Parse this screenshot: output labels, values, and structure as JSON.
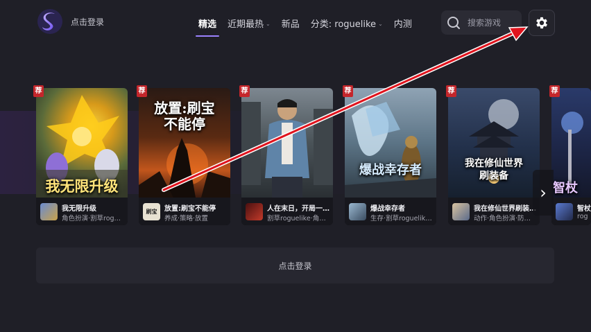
{
  "header": {
    "login_label": "点击登录",
    "nav": [
      {
        "label": "精选",
        "active": true,
        "dropdown": false
      },
      {
        "label": "近期最热",
        "active": false,
        "dropdown": true
      },
      {
        "label": "新品",
        "active": false,
        "dropdown": false
      },
      {
        "label": "分类: roguelike",
        "active": false,
        "dropdown": true
      },
      {
        "label": "内测",
        "active": false,
        "dropdown": false
      }
    ],
    "search_placeholder": "搜索游戏"
  },
  "cards": [
    {
      "art_title": "我无限升级",
      "name": "我无限升级",
      "tags": "角色扮演·割草rog…",
      "badge": "荐",
      "thumb_text": ""
    },
    {
      "art_title": "放置:刷宝\n不能停",
      "name": "放置:刷宝不能停",
      "tags": "养成·策略·放置",
      "badge": "荐",
      "thumb_text": "刷宝"
    },
    {
      "art_title": "",
      "name": "人在末日，开局一…",
      "tags": "割草roguelike·角…",
      "badge": "荐",
      "thumb_text": ""
    },
    {
      "art_title": "爆战幸存者",
      "name": "爆战幸存者",
      "tags": "生存·割草roguelik…",
      "badge": "荐",
      "thumb_text": ""
    },
    {
      "art_title": "我在修仙世界\n刷装备",
      "name": "我在修仙世界刷装…",
      "tags": "动作·角色扮演·防…",
      "badge": "荐",
      "thumb_text": ""
    },
    {
      "art_title": "智杖",
      "name": "智杖",
      "tags": "rog",
      "badge": "荐",
      "thumb_text": ""
    }
  ],
  "login_bar_label": "点击登录",
  "colors": {
    "background": "#1f1f27",
    "accent": "#9b82ff",
    "badge": "#c4262b",
    "annotation_arrow": "#e0141e"
  },
  "icons": {
    "logo": "s-logo-icon",
    "search": "search-icon",
    "settings": "gear-icon",
    "next": "chevron-right-icon"
  }
}
